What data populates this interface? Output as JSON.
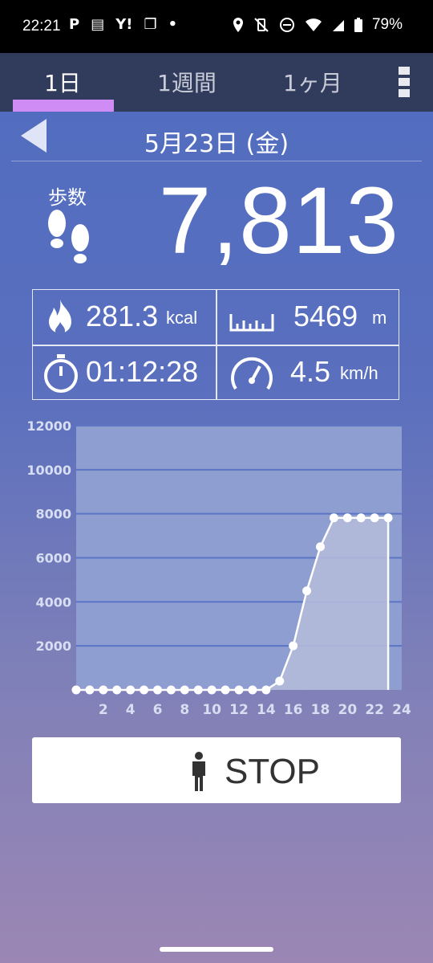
{
  "status_bar": {
    "time": "22:21",
    "left_icons": [
      "p-icon",
      "news-icon",
      "yahoo-icon",
      "copy-icon",
      "dot-icon"
    ],
    "left_text": [
      "P",
      "▤",
      "Y!",
      "❐",
      "•"
    ],
    "battery": "79%"
  },
  "tabs": [
    {
      "label": "1日",
      "active": true
    },
    {
      "label": "1週間",
      "active": false
    },
    {
      "label": "1ヶ月",
      "active": false
    }
  ],
  "date": "5月23日 (金)",
  "steps": {
    "label": "歩数",
    "value": "7,813"
  },
  "stats": {
    "calories": {
      "value": "281.3",
      "unit": "kcal"
    },
    "distance": {
      "value": "5469",
      "unit": "m"
    },
    "duration": {
      "value": "01:12:28"
    },
    "speed": {
      "value": "4.5",
      "unit": "km/h"
    }
  },
  "chart_data": {
    "type": "area",
    "x": [
      0,
      1,
      2,
      3,
      4,
      5,
      6,
      7,
      8,
      9,
      10,
      11,
      12,
      13,
      14,
      15,
      16,
      17,
      18,
      19,
      20,
      21,
      22,
      23
    ],
    "values": [
      0,
      0,
      0,
      0,
      0,
      0,
      0,
      0,
      0,
      0,
      0,
      0,
      0,
      0,
      0,
      400,
      2000,
      4500,
      6500,
      7813,
      7813,
      7813,
      7813,
      7813
    ],
    "x_ticks": [
      "2",
      "4",
      "6",
      "8",
      "10",
      "12",
      "14",
      "16",
      "18",
      "20",
      "22",
      "24"
    ],
    "y_ticks": [
      "2000",
      "4000",
      "6000",
      "8000",
      "10000",
      "12000"
    ],
    "ylim": [
      0,
      12000
    ],
    "xlim": [
      0,
      24
    ],
    "grid": true,
    "colors": {
      "fill": "#b6bcdc",
      "line": "#ffffff",
      "plot_bg": "#8e9ed0",
      "grid": "#5c74c4",
      "tick": "#d8def2"
    }
  },
  "stop_button": {
    "label": "STOP"
  }
}
